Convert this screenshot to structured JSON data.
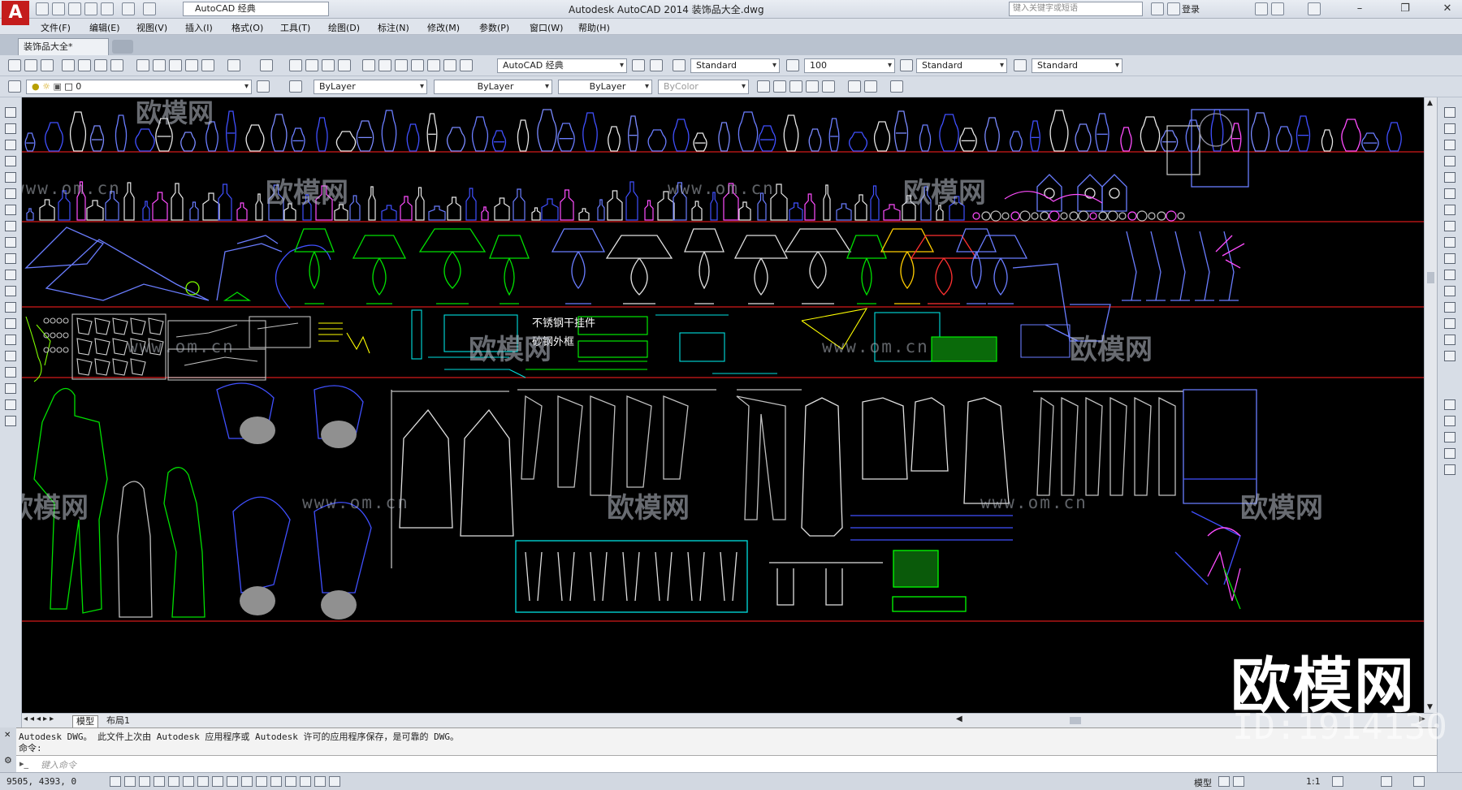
{
  "app": {
    "logo_letter": "A",
    "title": "Autodesk AutoCAD 2014    装饰品大全.dwg",
    "workspace": "AutoCAD 经典",
    "search_placeholder": "键入关键字或短语",
    "login_label": "登录"
  },
  "menu": [
    "文件(F)",
    "编辑(E)",
    "视图(V)",
    "插入(I)",
    "格式(O)",
    "工具(T)",
    "绘图(D)",
    "标注(N)",
    "修改(M)",
    "参数(P)",
    "窗口(W)",
    "帮助(H)"
  ],
  "file_tab": {
    "label": "装饰品大全*"
  },
  "toolbar": {
    "workspace_select": "AutoCAD 经典",
    "text_style": "Standard",
    "dim_scale": "100",
    "dim_style": "Standard",
    "table_style": "Standard"
  },
  "layers": {
    "current_layer": "0",
    "color": "ByLayer",
    "linetype": "ByLayer",
    "lineweight": "ByLayer",
    "plotstyle": "ByColor"
  },
  "canvas": {
    "labels": [
      "不锈钢干挂件",
      "砂钢外框"
    ],
    "shelf_color": "#b01616"
  },
  "layout_tabs": [
    "模型",
    "布局1"
  ],
  "command": {
    "history_line1": "Autodesk DWG。  此文件上次由 Autodesk 应用程序或 Autodesk 许可的应用程序保存，是可靠的 DWG。",
    "history_line2": "命令:",
    "input_placeholder": "键入命令"
  },
  "status": {
    "coords": "9505, 4393, 0",
    "model_label": "模型",
    "scale_label": "1:1"
  },
  "watermark": {
    "brand": "欧模网",
    "url": "www.om.cn",
    "id": "ID:1914130"
  }
}
